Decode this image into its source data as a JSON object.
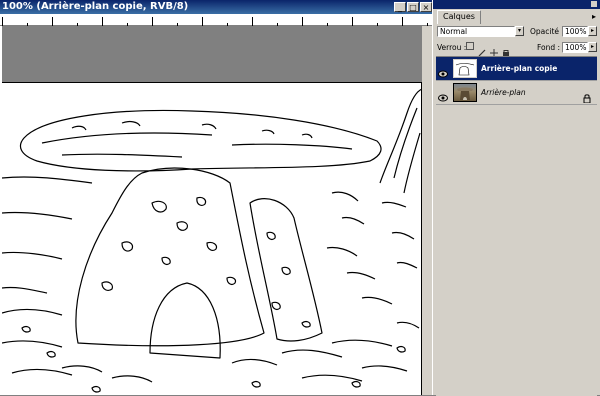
{
  "document": {
    "title": "100% (Arrière-plan copie, RVB/8)",
    "window_buttons": {
      "minimize": "_",
      "maximize": "□",
      "close": "×"
    }
  },
  "layers_panel": {
    "tab": "Calques",
    "menu_glyph": "▸",
    "blend_mode": "Normal",
    "opacity_label": "Opacité :",
    "opacity_value": "100%",
    "lock_label": "Verrou :",
    "fill_label": "Fond :",
    "fill_value": "100%",
    "layers": [
      {
        "name": "Arrière-plan copie",
        "selected": true,
        "italic": false,
        "locked": false
      },
      {
        "name": "Arrière-plan",
        "selected": false,
        "italic": true,
        "locked": true
      }
    ]
  },
  "colors": {
    "selection": "#0a246a",
    "panel": "#d4d0c8",
    "workspace": "#808080"
  }
}
